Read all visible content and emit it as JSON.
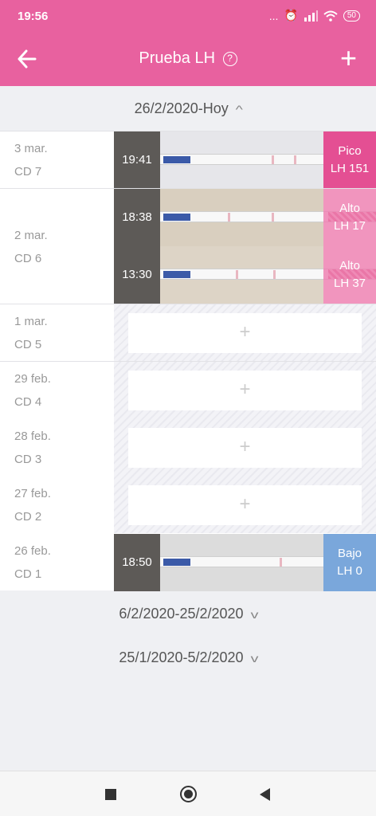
{
  "status_bar": {
    "time": "19:56",
    "dots": "...",
    "alarm_icon": "alarm-icon",
    "signal_icon": "signal-icon",
    "wifi_icon": "wifi-icon",
    "battery": "50"
  },
  "header": {
    "title": "Prueba LH",
    "help_icon": "?",
    "back_icon": "arrow-left-icon",
    "add_icon": "+"
  },
  "ranges": [
    {
      "label": "26/2/2020-Hoy",
      "expanded": true
    },
    {
      "label": "6/2/2020-25/2/2020",
      "expanded": false
    },
    {
      "label": "25/1/2020-5/2/2020",
      "expanded": false
    }
  ],
  "days": [
    {
      "date": "3 mar.",
      "cd": "CD 7",
      "tests": [
        {
          "time": "19:41",
          "level": "Pico",
          "value": "LH 151"
        }
      ]
    },
    {
      "date": "2 mar.",
      "cd": "CD 6",
      "tests": [
        {
          "time": "18:38",
          "level": "Alto",
          "value": "LH 17"
        },
        {
          "time": "13:30",
          "level": "Alto",
          "value": "LH 37"
        }
      ]
    },
    {
      "date": "1 mar.",
      "cd": "CD 5",
      "add": "+"
    },
    {
      "date": "29 feb.",
      "cd": "CD 4",
      "add": "+"
    },
    {
      "date": "28 feb.",
      "cd": "CD 3",
      "add": "+"
    },
    {
      "date": "27 feb.",
      "cd": "CD 2",
      "add": "+"
    },
    {
      "date": "26 feb.",
      "cd": "CD 1",
      "tests": [
        {
          "time": "18:50",
          "level": "Bajo",
          "value": "LH 0"
        }
      ]
    }
  ],
  "nav": {
    "recents_icon": "square-icon",
    "home_icon": "circle-icon",
    "back_icon": "triangle-back-icon"
  }
}
